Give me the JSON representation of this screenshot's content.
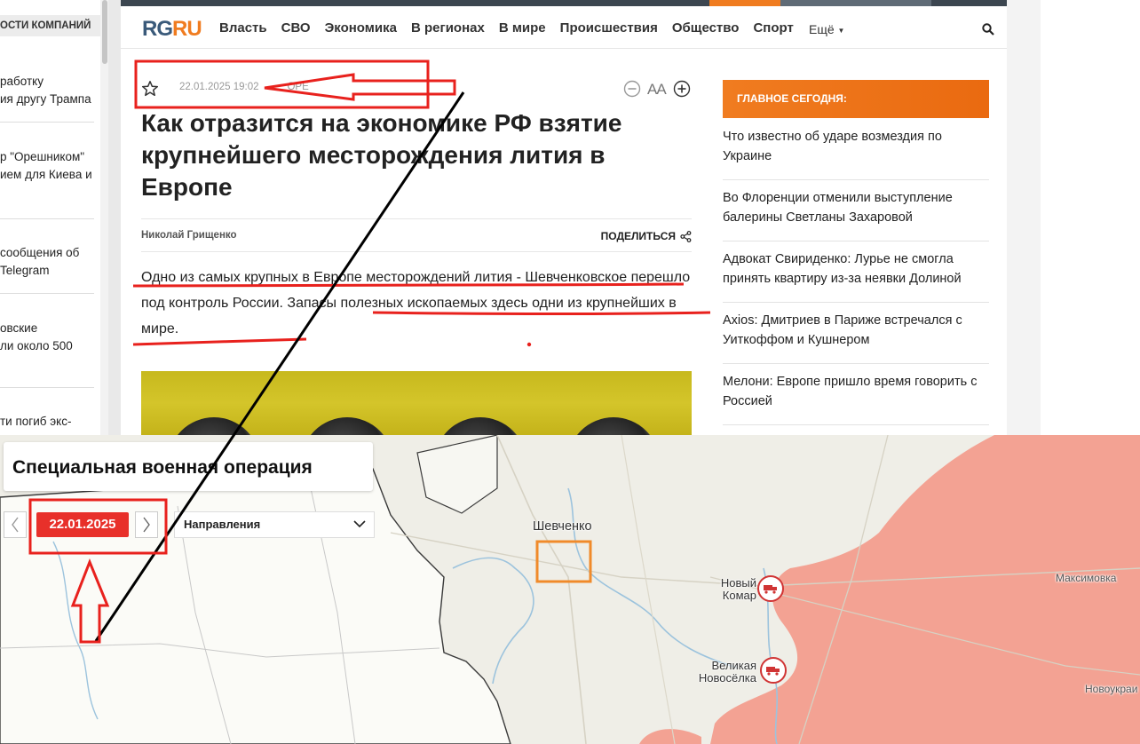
{
  "left_strip": {
    "header": "ОСТИ КОМПАНИЙ",
    "items": [
      [
        "работку",
        "ия другу Трампа"
      ],
      [
        "р \"Орешником\"",
        "ием для Киева и"
      ],
      [
        "сообщения об",
        "Telegram"
      ],
      [
        "овские",
        "ли около 500"
      ],
      [
        "ти погиб экс-"
      ]
    ]
  },
  "header": {
    "logo_part1": "RG",
    "logo_part2": "RU",
    "nav": [
      "Власть",
      "СВО",
      "Экономика",
      "В регионах",
      "В мире",
      "Происшествия",
      "Общество",
      "Спорт"
    ],
    "more": "Ещё",
    "icons": {
      "search": "search-icon"
    }
  },
  "article": {
    "date": "22.01.2025 19:02",
    "date_tail": "ОРЕ",
    "font_label": "AA",
    "title": "Как отразится на экономике РФ взятие крупнейшего месторождения лития в Европе",
    "author": "Николай Грищенко",
    "share_label": "ПОДЕЛИТЬСЯ",
    "lead": "Одно из самых крупных в Европе месторождений лития - Шевченковское перешло под контроль России. Запасы полезных ископаемых здесь одни из крупнейших в мире."
  },
  "sidebar": {
    "heading": "ГЛАВНОЕ СЕГОДНЯ:",
    "items": [
      "Что известно об ударе возмездия по Украине",
      "Во Флоренции отменили выступление балерины Светланы Захаровой",
      "Адвокат Свириденко: Лурье не смогла принять квартиру из-за неявки Долиной",
      "Axios: Дмитриев в Париже встречался с Уиткоффом и Кушнером",
      "Мелони: Европе пришло время говорить с Россией"
    ]
  },
  "map": {
    "title": "Специальная военная операция",
    "date": "22.01.2025",
    "directions": "Направления",
    "labels": {
      "shevchenko": "Шевченко",
      "novy_komar": "Новый\nКомар",
      "velikaya": "Великая\nНовосёлка",
      "maksimovka": "Максимовка",
      "novoukrainka": "Новоукраи"
    },
    "colors": {
      "controlled_zone": "#f3998a",
      "accent": "#e8302a",
      "marker": "#f08a2a"
    }
  }
}
